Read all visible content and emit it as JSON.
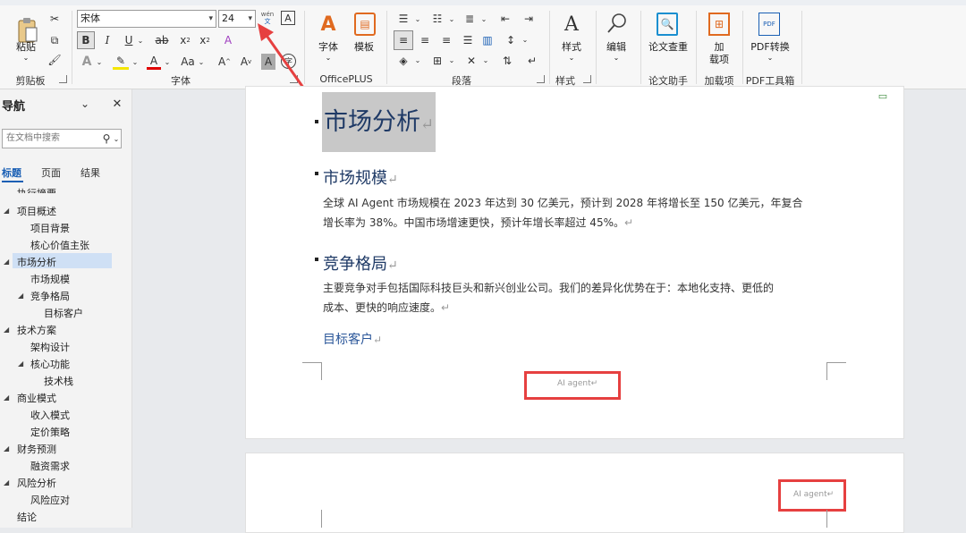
{
  "ribbon": {
    "clipboard": {
      "paste_label": "粘贴",
      "group_label": "剪贴板"
    },
    "font": {
      "font_name": "宋体",
      "font_size": "24",
      "group_label": "字体",
      "phonetic_label": "wén"
    },
    "officeplus": {
      "font_label": "字体",
      "template_label": "模板",
      "group_label": "OfficePLUS"
    },
    "paragraph": {
      "group_label": "段落"
    },
    "styles": {
      "style_label": "样式",
      "group_label": "样式"
    },
    "editing": {
      "edit_label": "编辑"
    },
    "thesis": {
      "check_label": "论文查重",
      "group_label": "论文助手"
    },
    "addins": {
      "label_line1": "加",
      "label_line2": "载项",
      "group_label": "加载项"
    },
    "pdf": {
      "convert_label": "PDF转换",
      "group_label": "PDF工具箱",
      "icon_text": "PDF"
    }
  },
  "nav": {
    "title": "导航",
    "search_placeholder": "在文档中搜索",
    "tabs": [
      "标题",
      "页面",
      "结果"
    ],
    "items": [
      {
        "label": "执行摘要",
        "level": 1
      },
      {
        "label": "项目概述",
        "level": 1
      },
      {
        "label": "项目背景",
        "level": 2
      },
      {
        "label": "核心价值主张",
        "level": 2
      },
      {
        "label": "市场分析",
        "level": 1,
        "selected": true
      },
      {
        "label": "市场规模",
        "level": 2
      },
      {
        "label": "竞争格局",
        "level": 2
      },
      {
        "label": "目标客户",
        "level": 3
      },
      {
        "label": "技术方案",
        "level": 1
      },
      {
        "label": "架构设计",
        "level": 2
      },
      {
        "label": "核心功能",
        "level": 2
      },
      {
        "label": "技术栈",
        "level": 3
      },
      {
        "label": "商业模式",
        "level": 1
      },
      {
        "label": "收入模式",
        "level": 2
      },
      {
        "label": "定价策略",
        "level": 2
      },
      {
        "label": "财务预测",
        "level": 1
      },
      {
        "label": "融资需求",
        "level": 2
      },
      {
        "label": "风险分析",
        "level": 1
      },
      {
        "label": "风险应对",
        "level": 2
      },
      {
        "label": "结论",
        "level": 1
      }
    ]
  },
  "document": {
    "heading1": "市场分析",
    "section1_title": "市场规模",
    "section1_line1": "全球 AI Agent 市场规模在 2023 年达到 30 亿美元，预计到 2028 年将增长至 150 亿美元，年复合",
    "section1_line2": "增长率为 38%。中国市场增速更快，预计年增长率超过 45%。",
    "section2_title": "竞争格局",
    "section2_line1": "主要竞争对手包括国际科技巨头和新兴创业公司。我们的差异化优势在于：本地化支持、更低的",
    "section2_line2": "成本、更快的响应速度。",
    "section3_title": "目标客户",
    "footer_text": "AI agent",
    "header_text_page2": "AI agent",
    "paragraph_mark": "↵"
  },
  "colors": {
    "annotation_red": "#e64040",
    "heading_blue": "#1f3a66",
    "nav_selected": "#cfe0f5"
  }
}
